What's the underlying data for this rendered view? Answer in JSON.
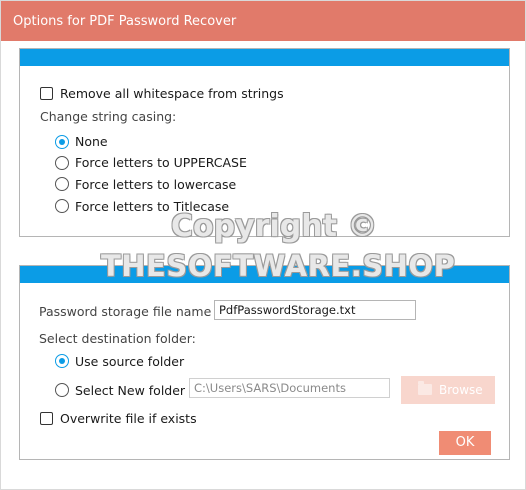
{
  "window": {
    "title": "Options for PDF Password Recover"
  },
  "strings_panel": {
    "remove_whitespace_label": "Remove all whitespace from strings",
    "remove_whitespace_checked": false,
    "casing_label": "Change string casing:",
    "casing_options": [
      {
        "label": "None",
        "selected": true
      },
      {
        "label": "Force letters to UPPERCASE",
        "selected": false
      },
      {
        "label": "Force letters to lowercase",
        "selected": false
      },
      {
        "label": "Force letters to Titlecase",
        "selected": false
      }
    ]
  },
  "storage_panel": {
    "file_name_label": "Password storage file name",
    "file_name_value": "PdfPasswordStorage.txt",
    "destination_label": "Select destination folder:",
    "use_source_label": "Use source folder",
    "use_source_selected": true,
    "select_new_label": "Select New folder",
    "select_new_selected": false,
    "folder_path_value": "C:\\Users\\SARS\\Documents",
    "browse_label": "Browse",
    "overwrite_label": "Overwrite file if exists",
    "overwrite_checked": false
  },
  "ok_label": "OK",
  "watermark": {
    "line1": "Copyright ©",
    "line2": "THESOFTWARE.SHOP"
  },
  "colors": {
    "title_bar": "#e17a6a",
    "panel_header": "#0b9ce6",
    "radio_accent": "#0b9ce6",
    "ok_button": "#f08c74",
    "browse_button_disabled": "#f8d6cd"
  },
  "icons": {
    "browse": "folder-icon"
  }
}
